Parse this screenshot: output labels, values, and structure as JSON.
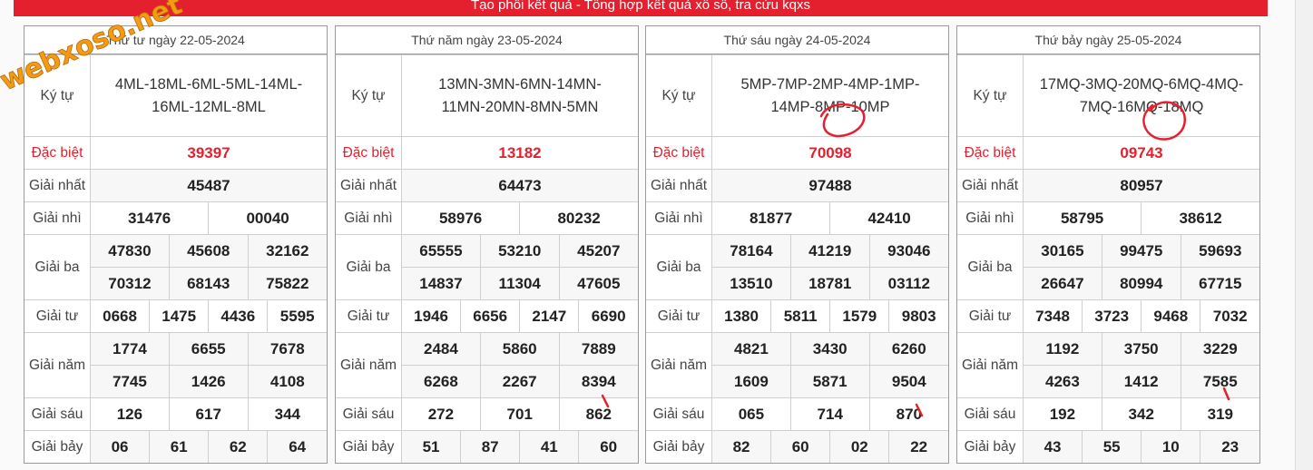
{
  "banner": "Tạo phôi kết quả - Tổng hợp kết quả xổ số, tra cứu kqxs",
  "watermark": "webxoso.net",
  "labels": {
    "ky_tu": "Ký tự",
    "dac_biet": "Đặc biệt",
    "giai_nhat": "Giải nhất",
    "giai_nhi": "Giải nhì",
    "giai_ba": "Giải ba",
    "giai_tu": "Giải tư",
    "giai_nam": "Giải năm",
    "giai_sau": "Giải sáu",
    "giai_bay": "Giải bảy"
  },
  "panels": [
    {
      "date": "Thứ tư ngày 22-05-2024",
      "ky_tu": [
        "4ML-18ML-6ML-5ML-14ML-",
        "16ML-12ML-8ML"
      ],
      "dac_biet": "39397",
      "giai_nhat": "45487",
      "giai_nhi": [
        "31476",
        "00040"
      ],
      "giai_ba": [
        "47830",
        "45608",
        "32162",
        "70312",
        "68143",
        "75822"
      ],
      "giai_tu": [
        "0668",
        "1475",
        "4436",
        "5595"
      ],
      "giai_nam": [
        "1774",
        "6655",
        "7678",
        "7745",
        "1426",
        "4108"
      ],
      "giai_sau": [
        "126",
        "617",
        "344"
      ],
      "giai_bay": [
        "06",
        "61",
        "62",
        "64"
      ]
    },
    {
      "date": "Thứ năm ngày 23-05-2024",
      "ky_tu": [
        "13MN-3MN-6MN-14MN-",
        "11MN-20MN-8MN-5MN"
      ],
      "dac_biet": "13182",
      "giai_nhat": "64473",
      "giai_nhi": [
        "58976",
        "80232"
      ],
      "giai_ba": [
        "65555",
        "53210",
        "45207",
        "14837",
        "11304",
        "47605"
      ],
      "giai_tu": [
        "1946",
        "6656",
        "2147",
        "6690"
      ],
      "giai_nam": [
        "2484",
        "5860",
        "7889",
        "6268",
        "2267",
        "8394"
      ],
      "giai_sau": [
        "272",
        "701",
        "862"
      ],
      "giai_bay": [
        "51",
        "87",
        "41",
        "60"
      ]
    },
    {
      "date": "Thứ sáu ngày 24-05-2024",
      "ky_tu": [
        "5MP-7MP-2MP-4MP-1MP-",
        "14MP-8MP-10MP"
      ],
      "dac_biet": "70098",
      "giai_nhat": "97488",
      "giai_nhi": [
        "81877",
        "42410"
      ],
      "giai_ba": [
        "78164",
        "41219",
        "93046",
        "13510",
        "18781",
        "03112"
      ],
      "giai_tu": [
        "1380",
        "5811",
        "1579",
        "9803"
      ],
      "giai_nam": [
        "4821",
        "3430",
        "6260",
        "1609",
        "5871",
        "9504"
      ],
      "giai_sau": [
        "065",
        "714",
        "870"
      ],
      "giai_bay": [
        "82",
        "60",
        "02",
        "22"
      ]
    },
    {
      "date": "Thứ bảy ngày 25-05-2024",
      "ky_tu": [
        "17MQ-3MQ-20MQ-6MQ-4MQ-",
        "7MQ-16MQ-18MQ"
      ],
      "dac_biet": "09743",
      "giai_nhat": "80957",
      "giai_nhi": [
        "58795",
        "38612"
      ],
      "giai_ba": [
        "30165",
        "99475",
        "59693",
        "26647",
        "80994",
        "67715"
      ],
      "giai_tu": [
        "7348",
        "3723",
        "9468",
        "7032"
      ],
      "giai_nam": [
        "1192",
        "3750",
        "3229",
        "4263",
        "1412",
        "7585"
      ],
      "giai_sau": [
        "192",
        "342",
        "319"
      ],
      "giai_bay": [
        "43",
        "55",
        "10",
        "23"
      ]
    }
  ],
  "colors": {
    "accent_red": "#e5202e",
    "watermark_orange": "#f39a16",
    "annotation_red": "#e5202e"
  }
}
